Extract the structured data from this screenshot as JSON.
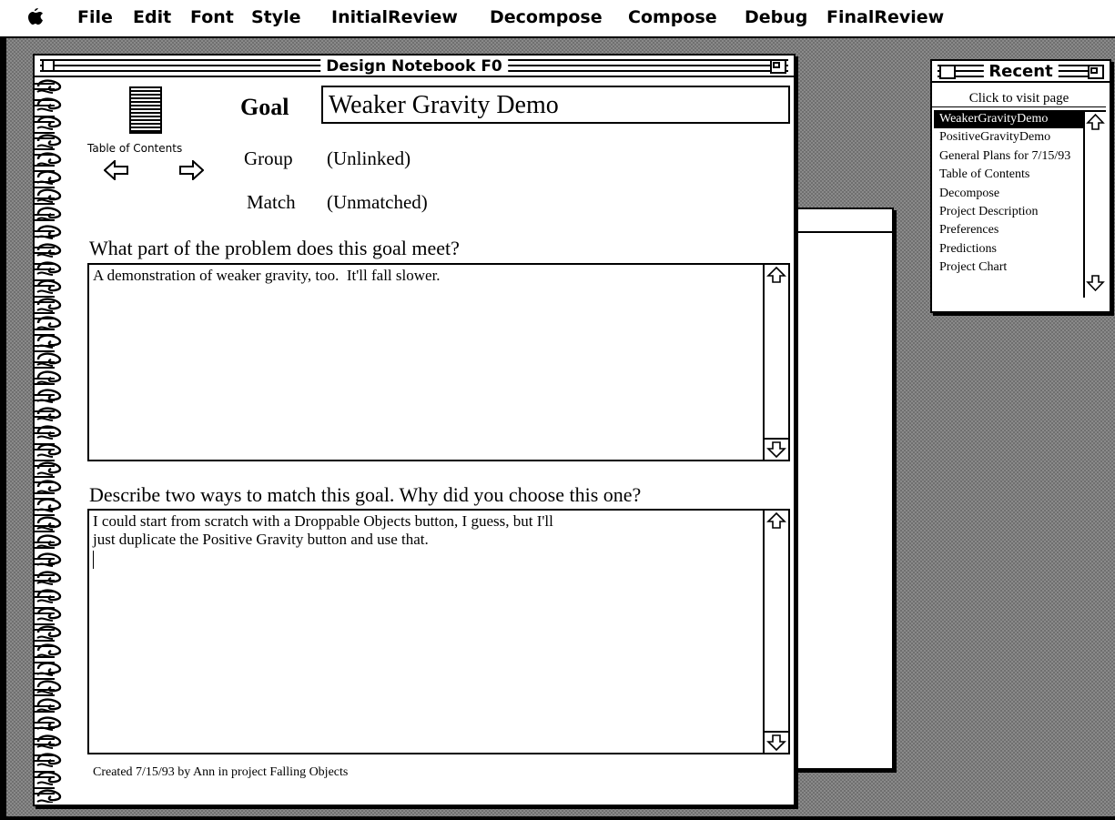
{
  "menubar": {
    "apple_icon": "apple-icon",
    "items": [
      "File",
      "Edit",
      "Font",
      "Style",
      "InitialReview",
      "Decompose",
      "Compose",
      "Debug",
      "FinalReview"
    ]
  },
  "notebook": {
    "title": "Design Notebook F0",
    "toc_label": "Table of Contents",
    "goal_label": "Goal",
    "goal_value": "Weaker Gravity Demo",
    "group_label": "Group",
    "group_value": "(Unlinked)",
    "match_label": "Match",
    "match_value": "(Unmatched)",
    "question1": "What part of the problem does this goal meet?",
    "answer1": "A demonstration of weaker gravity, too.  It'll fall slower.",
    "question2": "Describe two ways to match this goal.  Why did you choose this one?",
    "answer2": "I could start from scratch with a Droppable Objects button, I guess, but I'll\njust duplicate the Positive Gravity button and use that.",
    "footer": "Created 7/15/93 by Ann in project Falling Objects"
  },
  "recent": {
    "title": "Recent",
    "hint": "Click to visit page",
    "items": [
      "WeakerGravityDemo",
      "PositiveGravityDemo",
      "General Plans for 7/15/93",
      "Table of Contents",
      "Decompose",
      "Project Description",
      "Preferences",
      "Predictions",
      "Project Chart"
    ],
    "selected_index": 0
  }
}
